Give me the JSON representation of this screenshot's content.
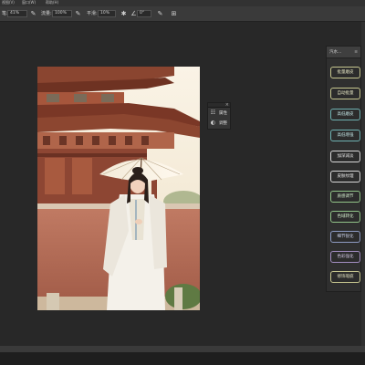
{
  "menubar": {
    "items": [
      "视图(V)",
      "窗口(W)",
      "帮助(H)"
    ]
  },
  "options_bar": {
    "size_label": "笔:",
    "size_value": "41%",
    "opacity_label": "流量:",
    "opacity_value": "100%",
    "smooth_label": "平滑:",
    "smooth_value": "10%",
    "angle_value": "0°"
  },
  "float_panel": {
    "rows": [
      {
        "icon": "properties-icon",
        "label": "属性"
      },
      {
        "icon": "adjustments-icon",
        "label": "调整"
      }
    ]
  },
  "right_panel": {
    "title": "汽水...",
    "buttons": [
      {
        "label": "批量磨皮",
        "color": "yellow"
      },
      {
        "label": "自动批量",
        "color": "yellow"
      },
      {
        "label": "高低磨皮",
        "color": "teal"
      },
      {
        "label": "高低增强",
        "color": "teal"
      },
      {
        "label": "加深减淡",
        "color": "white"
      },
      {
        "label": "皮肤纹理",
        "color": "white"
      },
      {
        "label": "质感调节",
        "color": "green"
      },
      {
        "label": "色域转化",
        "color": "green"
      },
      {
        "label": "细节锐化",
        "color": "blue"
      },
      {
        "label": "色彩强化",
        "color": "purple"
      },
      {
        "label": "修饰瑕疵",
        "color": "yellow"
      }
    ]
  },
  "colors": {
    "workspace": "#282828",
    "wall": "#b26a55",
    "roof": "#7e3a27"
  }
}
